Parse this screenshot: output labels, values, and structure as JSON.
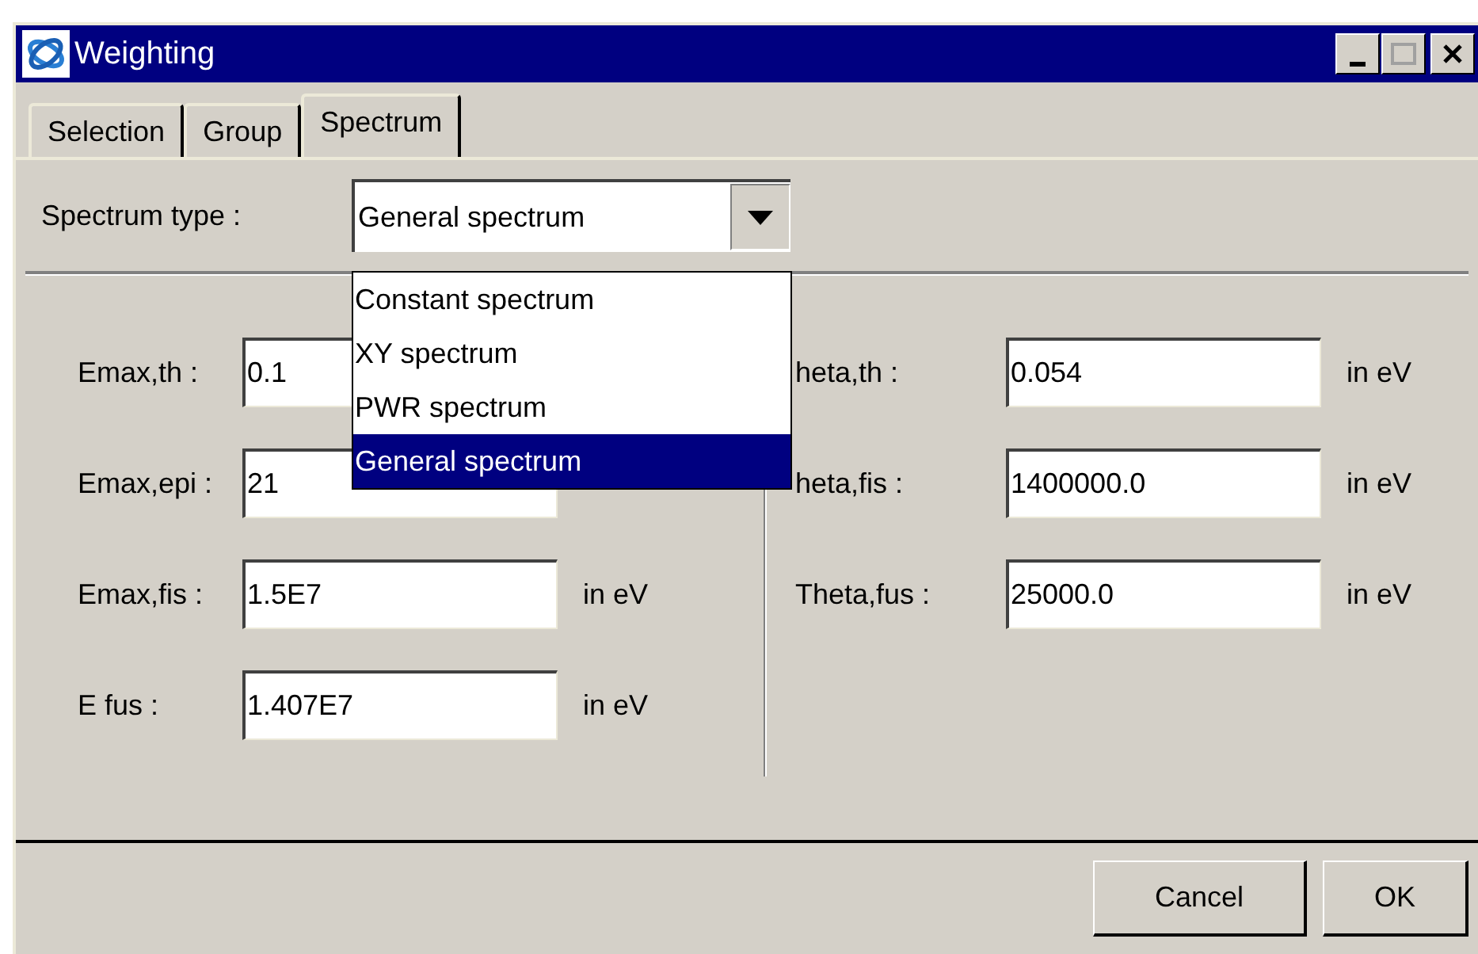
{
  "window": {
    "title": "Weighting"
  },
  "tabs": [
    {
      "label": "Selection",
      "selected": false
    },
    {
      "label": "Group",
      "selected": false
    },
    {
      "label": "Spectrum",
      "selected": true
    }
  ],
  "spectrum_type": {
    "label": "Spectrum type :",
    "value": "General spectrum",
    "expanded": true,
    "options": [
      {
        "label": "Constant spectrum",
        "selected": false
      },
      {
        "label": "XY spectrum",
        "selected": false
      },
      {
        "label": "PWR spectrum",
        "selected": false
      },
      {
        "label": "General spectrum",
        "selected": true
      }
    ]
  },
  "fields_left": [
    {
      "label": "Emax,th :",
      "value": "0.1"
    },
    {
      "label": "Emax,epi :",
      "value": "21"
    },
    {
      "label": "Emax,fis :",
      "value": "1.5E7",
      "unit": "in eV"
    },
    {
      "label": "E fus :",
      "value": "1.407E7",
      "unit": "in eV"
    }
  ],
  "fields_right": [
    {
      "label": "heta,th :",
      "value": "0.054",
      "unit": "in eV"
    },
    {
      "label": "heta,fis :",
      "value": "1400000.0",
      "unit": "in eV"
    },
    {
      "label": "Theta,fus :",
      "value": "25000.0",
      "unit": "in eV"
    }
  ],
  "buttons": [
    "Cancel",
    "OK"
  ]
}
